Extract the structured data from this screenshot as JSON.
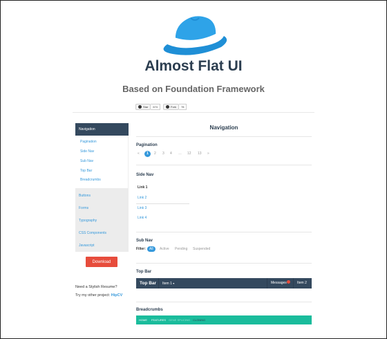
{
  "header": {
    "title": "Almost Flat UI",
    "subtitle": "Based on Foundation Framework",
    "logo": "hat-logo",
    "github": [
      {
        "label": "Star",
        "count": "674"
      },
      {
        "label": "Fork",
        "count": "78"
      }
    ]
  },
  "sidebar": {
    "heading": "Navigation",
    "sub_items": [
      "Pagination",
      "Side Nav",
      "Sub Nav",
      "Top Bar",
      "Breadcrumbs"
    ],
    "items": [
      "Buttons",
      "Forms",
      "Typography",
      "CSS Components",
      "Javascript"
    ]
  },
  "download_label": "Download",
  "promo": {
    "line1": "Need a Stylish Resume?",
    "line2_prefix": "Try my other project: ",
    "line2_link": "HipCV"
  },
  "main": {
    "title": "Navigation",
    "pagination": {
      "title": "Pagination",
      "prev": "«",
      "pages": [
        "1",
        "2",
        "3",
        "4",
        "…",
        "12",
        "13"
      ],
      "current": "1",
      "next": "»"
    },
    "side_nav": {
      "title": "Side Nav",
      "links": [
        "Link 1",
        "Link 2",
        "Link 3",
        "Link 4"
      ]
    },
    "sub_nav": {
      "title": "Sub Nav",
      "filter_label": "Filter:",
      "items": [
        "All",
        "Active",
        "Pending",
        "Suspended"
      ]
    },
    "top_bar": {
      "title": "Top Bar",
      "brand": "Top Bar",
      "item1": "Item 1",
      "messages": "Messages",
      "item2": "Item 2"
    },
    "breadcrumbs": {
      "title": "Breadcrumbs",
      "items": [
        "Home",
        "Features",
        "Gene Splicing",
        "Cloning"
      ]
    }
  },
  "colors": {
    "primary": "#3498db",
    "dark": "#34495e",
    "danger": "#e74c3c",
    "turquoise": "#1abc9c"
  }
}
